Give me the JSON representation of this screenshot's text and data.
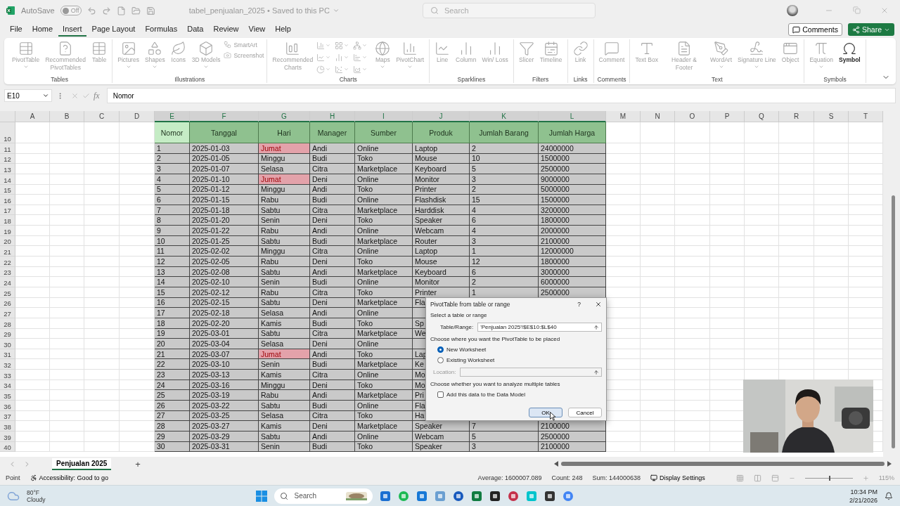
{
  "title_bar": {
    "autosave_label": "AutoSave",
    "autosave_on": false,
    "autosave_state": "Off",
    "document_title": "tabel_penjualan_2025 • Saved to this PC",
    "search_placeholder": "Search"
  },
  "menu_tabs": [
    {
      "label": "File",
      "selected": false
    },
    {
      "label": "Home",
      "selected": false
    },
    {
      "label": "Insert",
      "selected": true
    },
    {
      "label": "Page Layout",
      "selected": false
    },
    {
      "label": "Formulas",
      "selected": false
    },
    {
      "label": "Data",
      "selected": false
    },
    {
      "label": "Review",
      "selected": false
    },
    {
      "label": "View",
      "selected": false
    },
    {
      "label": "Help",
      "selected": false
    }
  ],
  "comments_button": "Comments",
  "share_button": "Share",
  "ribbon_groups": [
    {
      "label": "Tables",
      "items": [
        {
          "kind": "large",
          "label": "PivotTable",
          "disabled": true,
          "dropdown": true
        },
        {
          "kind": "large",
          "label": "Recommended PivotTables",
          "disabled": true,
          "dropdown": false
        },
        {
          "kind": "large",
          "label": "Table",
          "disabled": true,
          "dropdown": false
        }
      ]
    },
    {
      "label": "Illustrations",
      "items": [
        {
          "kind": "large",
          "label": "Pictures",
          "disabled": true,
          "dropdown": true
        },
        {
          "kind": "large",
          "label": "Shapes",
          "disabled": true,
          "dropdown": true
        },
        {
          "kind": "large",
          "label": "Icons",
          "disabled": true,
          "dropdown": false
        },
        {
          "kind": "large",
          "label": "3D Models",
          "disabled": true,
          "dropdown": true
        },
        {
          "kind": "small",
          "labels": [
            "SmartArt",
            "Screenshot"
          ],
          "disabled": true
        }
      ]
    },
    {
      "label": "Charts",
      "items": [
        {
          "kind": "large",
          "label": "Recommended Charts",
          "disabled": true,
          "dropdown": false
        },
        {
          "kind": "iconset",
          "disabled": true
        },
        {
          "kind": "large",
          "label": "Maps",
          "disabled": true,
          "dropdown": true
        },
        {
          "kind": "large",
          "label": "PivotChart",
          "disabled": true,
          "dropdown": true
        }
      ]
    },
    {
      "label": "Sparklines",
      "items": [
        {
          "kind": "large",
          "label": "Line",
          "disabled": true,
          "dropdown": false
        },
        {
          "kind": "large",
          "label": "Column",
          "disabled": true,
          "dropdown": false
        },
        {
          "kind": "large",
          "label": "Win/ Loss",
          "disabled": true,
          "dropdown": false
        }
      ]
    },
    {
      "label": "Filters",
      "items": [
        {
          "kind": "large",
          "label": "Slicer",
          "disabled": true,
          "dropdown": false
        },
        {
          "kind": "large",
          "label": "Timeline",
          "disabled": true,
          "dropdown": false
        }
      ]
    },
    {
      "label": "Links",
      "items": [
        {
          "kind": "large",
          "label": "Link",
          "disabled": true,
          "dropdown": false
        }
      ]
    },
    {
      "label": "Comments",
      "items": [
        {
          "kind": "large",
          "label": "Comment",
          "disabled": true,
          "dropdown": false
        }
      ]
    },
    {
      "label": "Text",
      "items": [
        {
          "kind": "large",
          "label": "Text Box",
          "disabled": true,
          "dropdown": false
        },
        {
          "kind": "large",
          "label": "Header & Footer",
          "disabled": true,
          "dropdown": false
        },
        {
          "kind": "large",
          "label": "WordArt",
          "disabled": true,
          "dropdown": true
        },
        {
          "kind": "large",
          "label": "Signature Line",
          "disabled": true,
          "dropdown": true
        },
        {
          "kind": "large",
          "label": "Object",
          "disabled": true,
          "dropdown": false
        }
      ]
    },
    {
      "label": "Symbols",
      "items": [
        {
          "kind": "large",
          "label": "Equation",
          "disabled": true,
          "dropdown": true
        },
        {
          "kind": "large",
          "label": "Symbol",
          "disabled": false,
          "dropdown": false
        }
      ]
    }
  ],
  "formula_bar": {
    "name_box": "E10",
    "fx": "fx",
    "content": "Nomor"
  },
  "columns": [
    {
      "letter": "A",
      "selected": false
    },
    {
      "letter": "B",
      "selected": false
    },
    {
      "letter": "C",
      "selected": false
    },
    {
      "letter": "D",
      "selected": false
    },
    {
      "letter": "E",
      "selected": true
    },
    {
      "letter": "F",
      "selected": true
    },
    {
      "letter": "G",
      "selected": true
    },
    {
      "letter": "H",
      "selected": true
    },
    {
      "letter": "I",
      "selected": true
    },
    {
      "letter": "J",
      "selected": true
    },
    {
      "letter": "K",
      "selected": true
    },
    {
      "letter": "L",
      "selected": true
    },
    {
      "letter": "M",
      "selected": false
    },
    {
      "letter": "N",
      "selected": false
    },
    {
      "letter": "O",
      "selected": false
    },
    {
      "letter": "P",
      "selected": false
    },
    {
      "letter": "Q",
      "selected": false
    },
    {
      "letter": "R",
      "selected": false
    },
    {
      "letter": "S",
      "selected": false
    },
    {
      "letter": "T",
      "selected": false
    }
  ],
  "table": {
    "header_row": "10",
    "headers": [
      "Nomor",
      "Tanggal",
      "Hari",
      "Manager",
      "Sumber",
      "Produk",
      "Jumlah Barang",
      "Jumlah Harga"
    ],
    "rows": [
      {
        "row": "11",
        "flagged": true,
        "cells": [
          "1",
          "2025-01-03",
          "Jumat",
          "Andi",
          "Online",
          "Laptop",
          "2",
          "24000000"
        ]
      },
      {
        "row": "12",
        "flagged": false,
        "cells": [
          "2",
          "2025-01-05",
          "Minggu",
          "Budi",
          "Toko",
          "Mouse",
          "10",
          "1500000"
        ]
      },
      {
        "row": "13",
        "flagged": false,
        "cells": [
          "3",
          "2025-01-07",
          "Selasa",
          "Citra",
          "Marketplace",
          "Keyboard",
          "5",
          "2500000"
        ]
      },
      {
        "row": "14",
        "flagged": true,
        "cells": [
          "4",
          "2025-01-10",
          "Jumat",
          "Deni",
          "Online",
          "Monitor",
          "3",
          "9000000"
        ]
      },
      {
        "row": "15",
        "flagged": false,
        "cells": [
          "5",
          "2025-01-12",
          "Minggu",
          "Andi",
          "Toko",
          "Printer",
          "2",
          "5000000"
        ]
      },
      {
        "row": "16",
        "flagged": false,
        "cells": [
          "6",
          "2025-01-15",
          "Rabu",
          "Budi",
          "Online",
          "Flashdisk",
          "15",
          "1500000"
        ]
      },
      {
        "row": "17",
        "flagged": false,
        "cells": [
          "7",
          "2025-01-18",
          "Sabtu",
          "Citra",
          "Marketplace",
          "Harddisk",
          "4",
          "3200000"
        ]
      },
      {
        "row": "18",
        "flagged": false,
        "cells": [
          "8",
          "2025-01-20",
          "Senin",
          "Deni",
          "Toko",
          "Speaker",
          "6",
          "1800000"
        ]
      },
      {
        "row": "19",
        "flagged": false,
        "cells": [
          "9",
          "2025-01-22",
          "Rabu",
          "Andi",
          "Online",
          "Webcam",
          "4",
          "2000000"
        ]
      },
      {
        "row": "20",
        "flagged": false,
        "cells": [
          "10",
          "2025-01-25",
          "Sabtu",
          "Budi",
          "Marketplace",
          "Router",
          "3",
          "2100000"
        ]
      },
      {
        "row": "21",
        "flagged": false,
        "cells": [
          "11",
          "2025-02-02",
          "Minggu",
          "Citra",
          "Online",
          "Laptop",
          "1",
          "12000000"
        ]
      },
      {
        "row": "22",
        "flagged": false,
        "cells": [
          "12",
          "2025-02-05",
          "Rabu",
          "Deni",
          "Toko",
          "Mouse",
          "12",
          "1800000"
        ]
      },
      {
        "row": "23",
        "flagged": false,
        "cells": [
          "13",
          "2025-02-08",
          "Sabtu",
          "Andi",
          "Marketplace",
          "Keyboard",
          "6",
          "3000000"
        ]
      },
      {
        "row": "24",
        "flagged": false,
        "cells": [
          "14",
          "2025-02-10",
          "Senin",
          "Budi",
          "Online",
          "Monitor",
          "2",
          "6000000"
        ]
      },
      {
        "row": "25",
        "flagged": false,
        "cells": [
          "15",
          "2025-02-12",
          "Rabu",
          "Citra",
          "Toko",
          "Printer",
          "1",
          "2500000"
        ]
      },
      {
        "row": "26",
        "flagged": false,
        "cells": [
          "16",
          "2025-02-15",
          "Sabtu",
          "Deni",
          "Marketplace",
          "Fla"
        ]
      },
      {
        "row": "27",
        "flagged": false,
        "cells": [
          "17",
          "2025-02-18",
          "Selasa",
          "Andi",
          "Online"
        ]
      },
      {
        "row": "28",
        "flagged": false,
        "cells": [
          "18",
          "2025-02-20",
          "Kamis",
          "Budi",
          "Toko",
          "Sp"
        ]
      },
      {
        "row": "29",
        "flagged": false,
        "cells": [
          "19",
          "2025-03-01",
          "Sabtu",
          "Citra",
          "Marketplace",
          "We"
        ]
      },
      {
        "row": "30",
        "flagged": false,
        "cells": [
          "20",
          "2025-03-04",
          "Selasa",
          "Deni",
          "Online"
        ]
      },
      {
        "row": "31",
        "flagged": true,
        "cells": [
          "21",
          "2025-03-07",
          "Jumat",
          "Andi",
          "Toko",
          "Lap"
        ]
      },
      {
        "row": "32",
        "flagged": false,
        "cells": [
          "22",
          "2025-03-10",
          "Senin",
          "Budi",
          "Marketplace",
          "Ke"
        ]
      },
      {
        "row": "33",
        "flagged": false,
        "cells": [
          "23",
          "2025-03-13",
          "Kamis",
          "Citra",
          "Online",
          "Mo"
        ]
      },
      {
        "row": "34",
        "flagged": false,
        "cells": [
          "24",
          "2025-03-16",
          "Minggu",
          "Deni",
          "Toko",
          "Mo"
        ]
      },
      {
        "row": "35",
        "flagged": false,
        "cells": [
          "25",
          "2025-03-19",
          "Rabu",
          "Andi",
          "Marketplace",
          "Pri"
        ]
      },
      {
        "row": "36",
        "flagged": false,
        "cells": [
          "26",
          "2025-03-22",
          "Sabtu",
          "Budi",
          "Online",
          "Fla"
        ]
      },
      {
        "row": "37",
        "flagged": false,
        "cells": [
          "27",
          "2025-03-25",
          "Selasa",
          "Citra",
          "Toko",
          "Ha"
        ]
      },
      {
        "row": "38",
        "flagged": false,
        "cells": [
          "28",
          "2025-03-27",
          "Kamis",
          "Deni",
          "Marketplace",
          "Speaker",
          "7",
          "2100000"
        ]
      },
      {
        "row": "39",
        "flagged": false,
        "cells": [
          "29",
          "2025-03-29",
          "Sabtu",
          "Andi",
          "Online",
          "Webcam",
          "5",
          "2500000"
        ]
      },
      {
        "row": "40",
        "flagged": false,
        "cells": [
          "30",
          "2025-03-31",
          "Senin",
          "Budi",
          "Toko",
          "Speaker",
          "3",
          "2100000"
        ]
      }
    ]
  },
  "dialog": {
    "title": "PivotTable from table or range",
    "help": "?",
    "section_1": "Select a table or range",
    "range_label": "Table/Range:",
    "range_value": "'Penjualan 2025'!$E$10:$L$40",
    "section_2": "Choose where you want the PivotTable to be placed",
    "placement_options": [
      {
        "label": "New Worksheet",
        "selected": true
      },
      {
        "label": "Existing Worksheet",
        "selected": false
      }
    ],
    "location_label": "Location:",
    "location_disabled": true,
    "section_3": "Choose whether you want to analyze multiple tables",
    "data_model": {
      "label": "Add this data to the Data Model",
      "checked": false
    },
    "ok_button": "OK",
    "cancel_button": "Cancel"
  },
  "sheet_tabs": [
    {
      "label": "Penjualan 2025",
      "selected": true
    }
  ],
  "add_sheet": "+",
  "status_bar": {
    "mode": "Point",
    "accessibility": "Accessibility: Good to go",
    "average": "Average: 1600007.089",
    "count": "Count: 248",
    "sum": "Sum: 144000638",
    "display_settings": "Display Settings",
    "zoom_slider": {
      "level": 0.5
    },
    "zoom": "115%"
  },
  "taskbar": {
    "temperature": "80°F",
    "weather": "Cloudy",
    "search_placeholder": "Search",
    "time": "10:34 PM",
    "date": "2/21/2026"
  }
}
